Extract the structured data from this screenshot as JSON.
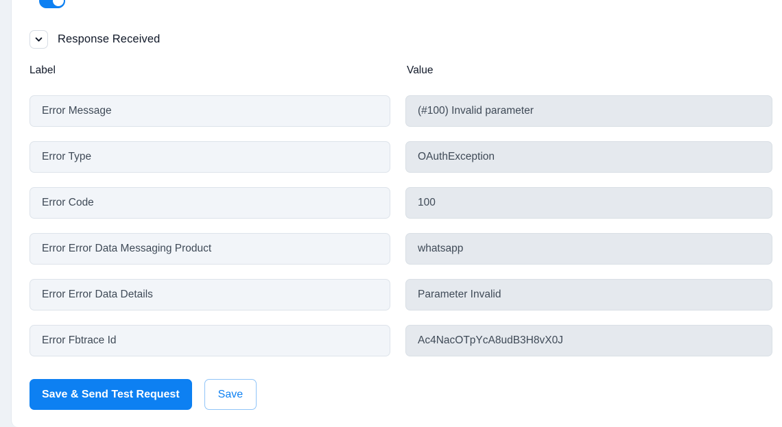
{
  "theme": {
    "accent_blue": "#0d80f2",
    "label_field_bg": "#f2f5f9",
    "value_field_bg": "#e5e9ee",
    "panel_bg": "#ffffff",
    "rail_bg": "#eef2f6",
    "text_primary": "#101828",
    "text_field": "#3f4a57"
  },
  "top_partial_row": {
    "label": "",
    "toggle_icon": "toggle-switch-on-icon",
    "toggle_state": "on"
  },
  "section": {
    "title": "Response Received",
    "collapse_icon": "chevron-down-icon",
    "expanded": true
  },
  "columns": {
    "label_header": "Label",
    "value_header": "Value"
  },
  "rows": [
    {
      "label": "Error Message",
      "value": "(#100) Invalid parameter",
      "resize_icon": "resize-grip-icon"
    },
    {
      "label": "Error Type",
      "value": "OAuthException",
      "resize_icon": "resize-grip-icon"
    },
    {
      "label": "Error Code",
      "value": "100",
      "resize_icon": "resize-grip-icon"
    },
    {
      "label": "Error Error Data Messaging Product",
      "value": "whatsapp",
      "resize_icon": "resize-grip-icon"
    },
    {
      "label": "Error Error Data Details",
      "value": "Parameter Invalid",
      "resize_icon": "resize-grip-icon"
    },
    {
      "label": "Error Fbtrace Id",
      "value": "Ac4NacOTpYcA8udB3H8vX0J",
      "resize_icon": "resize-grip-icon"
    }
  ],
  "actions": {
    "save_send_label": "Save & Send Test Request",
    "save_label": "Save"
  }
}
